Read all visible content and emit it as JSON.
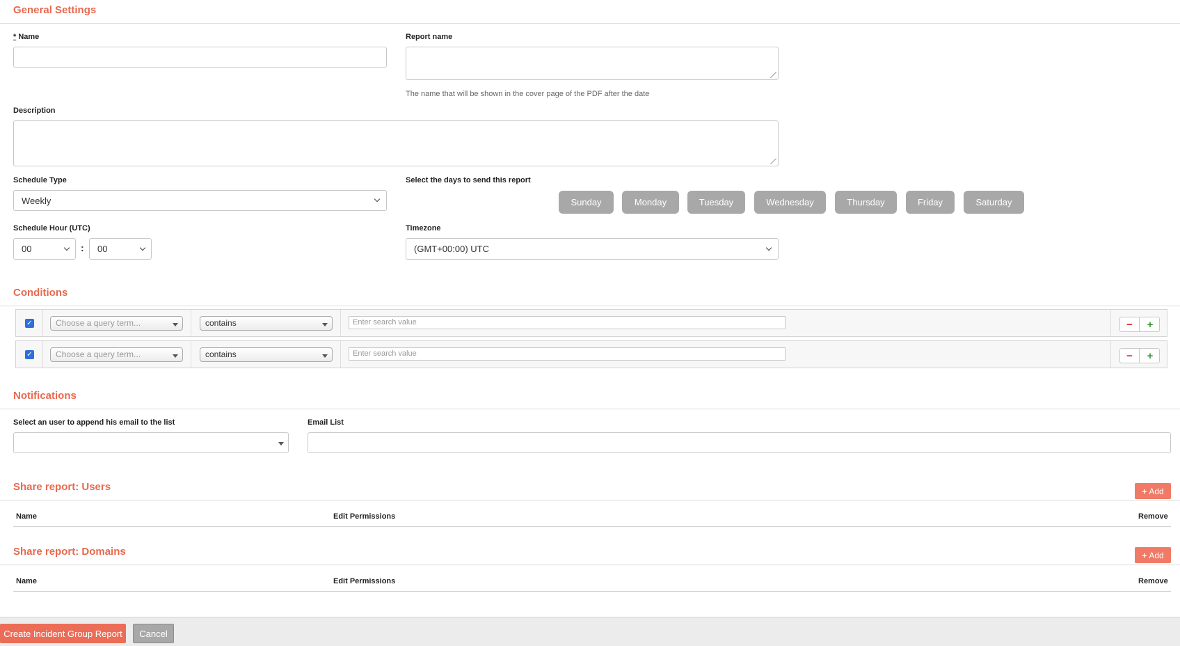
{
  "general": {
    "title": "General Settings",
    "name_required_mark": "*",
    "name_label": " Name",
    "report_name_label": "Report name",
    "report_name_help": "The name that will be shown in the cover page of the PDF after the date",
    "description_label": "Description",
    "schedule_type_label": "Schedule Type",
    "schedule_type_value": "Weekly",
    "days_label": "Select the days to send this report",
    "days": [
      "Sunday",
      "Monday",
      "Tuesday",
      "Wednesday",
      "Thursday",
      "Friday",
      "Saturday"
    ],
    "schedule_hour_label": "Schedule Hour (UTC)",
    "hour_value": "00",
    "minute_value": "00",
    "time_separator": ":",
    "timezone_label": "Timezone",
    "timezone_value": "(GMT+00:00) UTC"
  },
  "conditions": {
    "title": "Conditions",
    "rows": [
      {
        "checked": true,
        "term_placeholder": "Choose a query term...",
        "operator": "contains",
        "value_placeholder": "Enter search value"
      },
      {
        "checked": true,
        "term_placeholder": "Choose a query term...",
        "operator": "contains",
        "value_placeholder": "Enter search value"
      }
    ]
  },
  "notifications": {
    "title": "Notifications",
    "user_select_label": "Select an user to append his email to the list",
    "user_select_value": "",
    "email_list_label": "Email List",
    "email_list_value": ""
  },
  "share_users": {
    "title": "Share report: Users",
    "add_label": "Add",
    "columns": [
      "Name",
      "Edit Permissions",
      "Remove"
    ]
  },
  "share_domains": {
    "title": "Share report: Domains",
    "add_label": "Add",
    "columns": [
      "Name",
      "Edit Permissions",
      "Remove"
    ]
  },
  "footer": {
    "create_label": "Create Incident Group Report",
    "cancel_label": "Cancel"
  },
  "colors": {
    "accent": "#e8694f",
    "day_button": "#a8a8a8",
    "checkbox": "#2f6fd6"
  }
}
